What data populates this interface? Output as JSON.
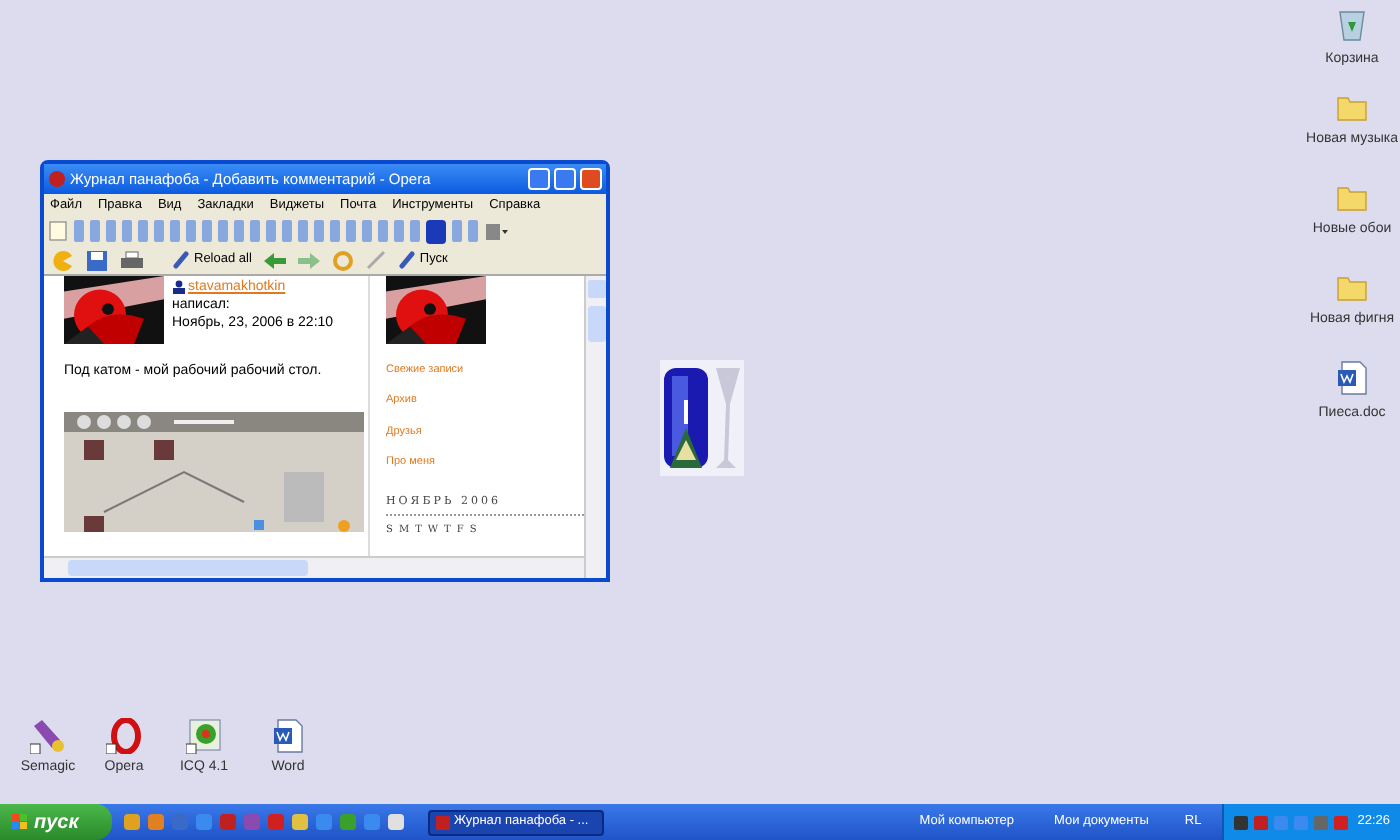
{
  "browser_window": {
    "title": "Журнал панафоба - Добавить комментарий - Opera",
    "menu": [
      "Файл",
      "Правка",
      "Вид",
      "Закладки",
      "Виджеты",
      "Почта",
      "Инструменты",
      "Справка"
    ],
    "tabs": [
      {
        "selected": false
      },
      {
        "selected": false
      },
      {
        "selected": false
      },
      {
        "selected": false
      },
      {
        "selected": false
      },
      {
        "selected": false
      },
      {
        "selected": false
      },
      {
        "selected": false
      },
      {
        "selected": false
      },
      {
        "selected": false
      },
      {
        "selected": false
      },
      {
        "selected": false
      },
      {
        "selected": false
      },
      {
        "selected": false
      },
      {
        "selected": false
      },
      {
        "selected": false
      },
      {
        "selected": false
      },
      {
        "selected": false
      },
      {
        "selected": false
      },
      {
        "selected": false
      },
      {
        "selected": false
      },
      {
        "selected": false
      },
      {
        "selected": true
      },
      {
        "selected": false
      },
      {
        "selected": false
      }
    ],
    "toolbar": {
      "reload_all": "Reload all",
      "go": "Пуск"
    },
    "post": {
      "author": "stavamakhotkin",
      "wrote": "написал:",
      "date": "Ноябрь, 23, 2006 в 22:10",
      "text": "Под катом - мой рабочий рабочий стол."
    },
    "sidebar_links": [
      "Свежие записи",
      "Архив",
      "Друзья",
      "Про меня"
    ],
    "calendar": {
      "title": "НОЯБРЬ 2006",
      "weekdays": [
        "S",
        "M",
        "T",
        "W",
        "T",
        "F",
        "S"
      ]
    }
  },
  "desktop_icons_right": [
    {
      "kind": "recycle",
      "label": "Корзина"
    },
    {
      "kind": "folder",
      "label": "Новая музыка"
    },
    {
      "kind": "folder",
      "label": "Новые обои"
    },
    {
      "kind": "folder",
      "label": "Новая фигня"
    },
    {
      "kind": "doc",
      "label": "Пиеса.doc"
    }
  ],
  "desktop_icons_bottom": [
    {
      "kind": "pen",
      "label": "Semagic"
    },
    {
      "kind": "opera",
      "label": "Opera"
    },
    {
      "kind": "flower",
      "label": "ICQ 4.1"
    },
    {
      "kind": "doc",
      "label": "Word"
    }
  ],
  "taskbar": {
    "start": "пуск",
    "task": "Журнал панафоба - ...",
    "toolbars": [
      "Мой компьютер",
      "Мои документы"
    ],
    "language": "RL",
    "clock": "22:26"
  }
}
